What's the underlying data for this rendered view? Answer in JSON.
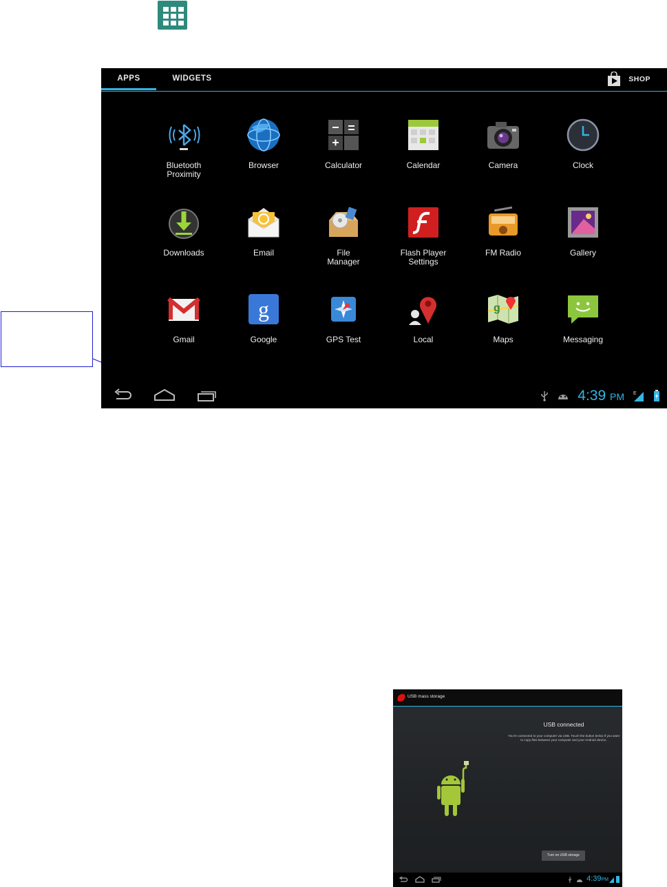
{
  "tabs": {
    "apps": "APPS",
    "widgets": "WIDGETS"
  },
  "shop_label": "SHOP",
  "apps": [
    {
      "label": "Bluetooth\nProximity",
      "icon": "bluetooth-icon"
    },
    {
      "label": "Browser",
      "icon": "globe-icon"
    },
    {
      "label": "Calculator",
      "icon": "calculator-icon"
    },
    {
      "label": "Calendar",
      "icon": "calendar-icon"
    },
    {
      "label": "Camera",
      "icon": "camera-icon"
    },
    {
      "label": "Clock",
      "icon": "clock-icon"
    },
    {
      "label": "Downloads",
      "icon": "download-icon"
    },
    {
      "label": "Email",
      "icon": "envelope-icon"
    },
    {
      "label": "File\nManager",
      "icon": "file-box-icon"
    },
    {
      "label": "Flash Player\nSettings",
      "icon": "flash-icon"
    },
    {
      "label": "FM Radio",
      "icon": "radio-icon"
    },
    {
      "label": "Gallery",
      "icon": "gallery-icon"
    },
    {
      "label": "Gmail",
      "icon": "gmail-icon"
    },
    {
      "label": "Google",
      "icon": "google-icon"
    },
    {
      "label": "GPS Test",
      "icon": "compass-icon"
    },
    {
      "label": "Local",
      "icon": "map-pin-icon"
    },
    {
      "label": "Maps",
      "icon": "map-icon"
    },
    {
      "label": "Messaging",
      "icon": "chat-bubble-icon"
    }
  ],
  "status": {
    "time": "4:39",
    "ampm": "PM",
    "network": "E"
  },
  "usb": {
    "title": "USB mass storage",
    "heading": "USB connected",
    "description": "You're connected to your computer via USB. Touch the button below if you want to copy files between your computer and your Android device.",
    "button": "Turn on USB storage",
    "time": "4:39",
    "ampm": "PM"
  },
  "colors": {
    "accent": "#33b5e5",
    "launcher": "#2e8a7c",
    "callout": "#1c1cd6",
    "android_green": "#a4c639"
  }
}
